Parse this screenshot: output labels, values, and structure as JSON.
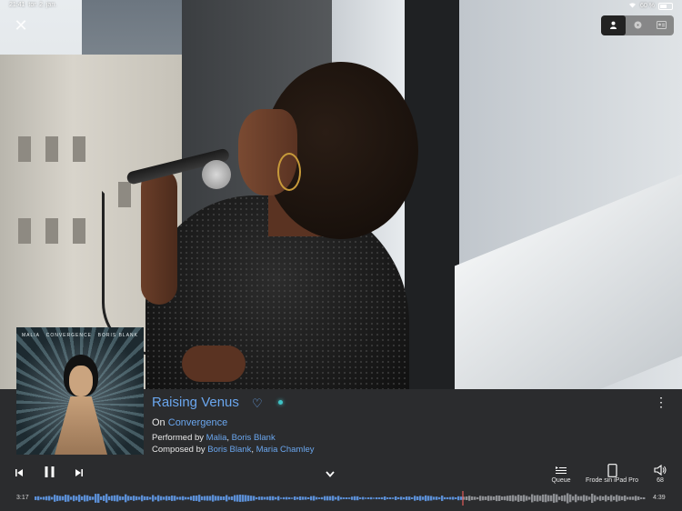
{
  "status_bar": {
    "time": "21:41",
    "date": "tor. 2. jan.",
    "battery": "60 %",
    "battery_level": 0.6
  },
  "view_switch": {
    "options": [
      "person-icon",
      "disc-icon",
      "credits-icon"
    ],
    "active_index": 0
  },
  "track": {
    "title": "Raising Venus",
    "album_prefix": "On",
    "album": "Convergence",
    "performed_prefix": "Performed by",
    "performers": [
      "Malia",
      "Boris Blank"
    ],
    "composed_prefix": "Composed by",
    "composers": [
      "Boris Blank",
      "Maria Chamley"
    ]
  },
  "album_art": {
    "artist_left": "MALIA",
    "album_center": "CONVERGENCE",
    "artist_right": "BORIS BLANK"
  },
  "player": {
    "elapsed": "3:17",
    "duration": "4:39",
    "progress": 0.7
  },
  "tools": {
    "queue_label": "Queue",
    "device_label": "Frode sin iPad Pro",
    "volume_value": "68"
  },
  "colors": {
    "accent": "#6aa6ee",
    "live": "#3fc3c6",
    "panel_bg": "#2b2c2e",
    "progress_played": "#5b8fd6"
  }
}
